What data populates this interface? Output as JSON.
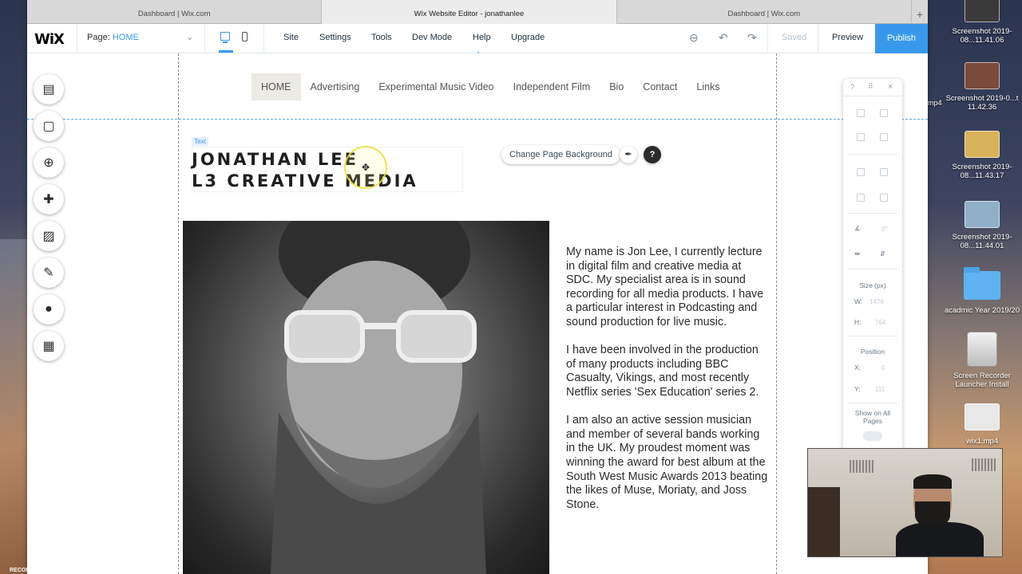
{
  "browser": {
    "tabs": [
      "Dashboard | Wix.com",
      "Wix Website Editor - jonathanlee",
      "Dashboard | Wix.com"
    ],
    "new_tab": "+"
  },
  "editor": {
    "logo": "WiX",
    "page_label": "Page:",
    "page_value": "HOME",
    "menu": [
      "Site",
      "Settings",
      "Tools",
      "Dev Mode",
      "Help",
      "Upgrade"
    ],
    "saved": "Saved",
    "preview": "Preview",
    "publish": "Publish",
    "collapse_glyph": "^"
  },
  "site": {
    "nav": [
      "HOME",
      "Advertising",
      "Experimental Music Video",
      "Independent Film",
      "Bio",
      "Contact",
      "Links"
    ],
    "text_tag": "Text",
    "title_line1": "JONATHAN LEE",
    "title_line2": "L3 CREATIVE MEDIA",
    "change_bg": "Change Page Background",
    "help_glyph": "?",
    "bio": [
      "My name is Jon Lee, I currently lecture in digital film and creative media at SDC. My specialist area is in sound recording for all media products. I have a particular interest in Podcasting and sound production for live music.",
      "I have been involved in the production of many products including BBC Casualty, Vikings, and most recently Netflix series 'Sex Education' series 2.",
      "I am also an active session musician and member of several bands working in the UK. My proudest moment was winning the award for best album at the South West Music Awards 2013 beating the likes of Muse, Moriaty, and Joss Stone."
    ]
  },
  "panel": {
    "help": "?",
    "close": "×",
    "size_label": "Size (px)",
    "w_label": "W:",
    "w_value": "1476",
    "h_label": "H:",
    "h_value": "764",
    "position_label": "Position",
    "x_label": "X:",
    "x_value": "0",
    "y_label": "Y:",
    "y_value": "111",
    "rotate_value": "0°",
    "show_all": "Show on All Pages"
  },
  "desktop": {
    "icons": [
      {
        "label": "Screenshot 2019-08...11.41.06"
      },
      {
        "label": "Screenshot 2019-0...t 11.42.36"
      },
      {
        "label": "Screenshot 2019-08...11.43.17"
      },
      {
        "label": "Screenshot 2019-08...11.44.01"
      },
      {
        "label": "acadmic Year 2019/20"
      },
      {
        "label": "Screen Recorder Launcher Install"
      },
      {
        "label": "wix1.mp4"
      }
    ],
    "mp4_fragment": "mp4",
    "recorded_with": "RECORDED WITH"
  }
}
